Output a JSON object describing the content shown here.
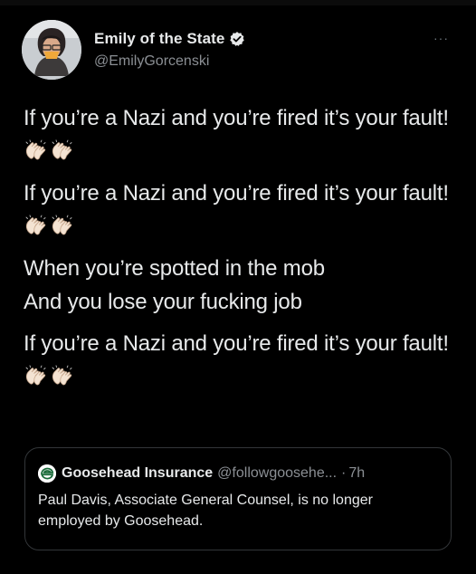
{
  "tweet": {
    "author": {
      "display_name": "Emily of the State",
      "handle": "@EmilyGorcenski",
      "verified": true,
      "avatar": "avatar-photo"
    },
    "more_label": "···",
    "paragraphs": [
      {
        "text": "If you’re a Nazi and you’re fired it’s your fault!",
        "emoji": [
          "clapping-hands-icon",
          "clapping-hands-icon"
        ]
      },
      {
        "text": "If you’re a Nazi and you’re fired it’s your fault!",
        "emoji": [
          "clapping-hands-icon",
          "clapping-hands-icon"
        ]
      },
      {
        "line1": "When you’re spotted in the mob",
        "line2": "And you lose your fucking job"
      },
      {
        "text": "If you’re a Nazi and you’re fired it’s your fault!",
        "emoji": [
          "clapping-hands-icon",
          "clapping-hands-icon"
        ]
      }
    ],
    "quote": {
      "display_name": "Goosehead Insurance",
      "handle": "@followgoosehe...",
      "separator": "·",
      "time": "7h",
      "avatar": "goosehead-logo-icon",
      "text": "Paul Davis, Associate General Counsel, is no longer employed by Goosehead."
    }
  },
  "colors": {
    "background": "#000000",
    "primary_text": "#e7e9ea",
    "secondary_text": "#8b8f94",
    "border": "#333639",
    "verified_badge": "#e7e9ea"
  }
}
